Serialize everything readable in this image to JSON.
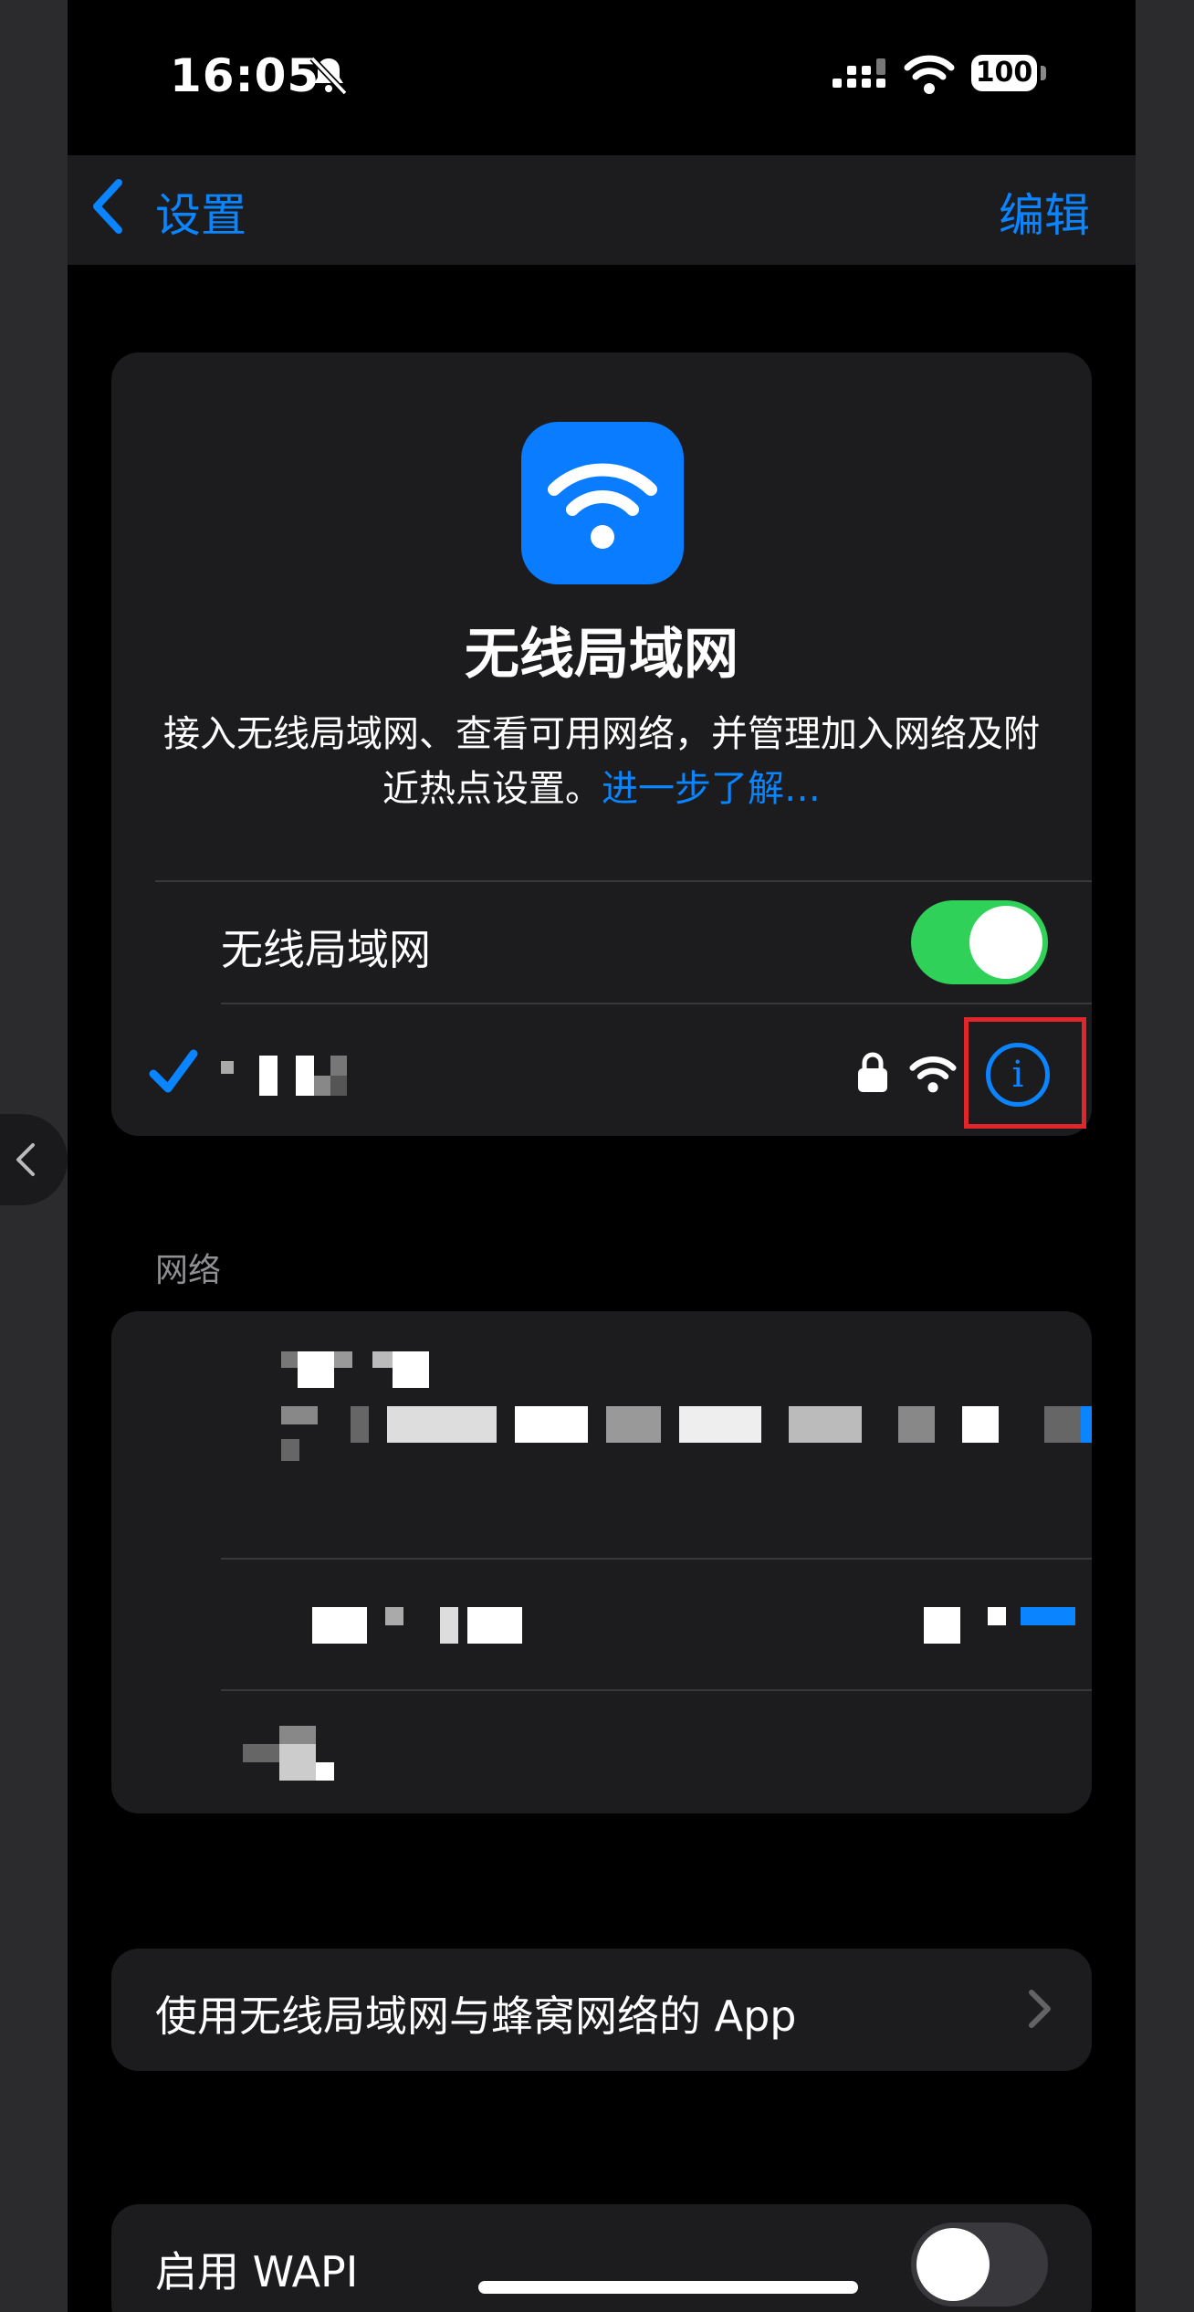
{
  "status_bar": {
    "time": "16:05",
    "battery": "100"
  },
  "nav": {
    "back_label": "设置",
    "edit_label": "编辑"
  },
  "wifi_card": {
    "title": "无线局域网",
    "description": "接入无线局域网、查看可用网络，并管理加入网络及附近热点设置。",
    "learn_more": "进一步了解…",
    "toggle_label": "无线局域网",
    "toggle_on": true,
    "info_glyph": "i"
  },
  "networks": {
    "section_label": "网络"
  },
  "apps_row": {
    "label": "使用无线局域网与蜂窝网络的 App"
  },
  "wapi_row": {
    "label": "启用 WAPI",
    "toggle_on": false
  },
  "colors": {
    "accent": "#0a84ff",
    "toggle_on": "#30d158",
    "highlight": "#e0262a",
    "app_icon": "#0a7cff"
  },
  "icons": [
    "bell-slash-icon",
    "cellular-signal-icon",
    "wifi-icon",
    "battery-icon",
    "chevron-left-icon",
    "checkmark-icon",
    "lock-icon",
    "info-icon",
    "chevron-right-icon"
  ]
}
